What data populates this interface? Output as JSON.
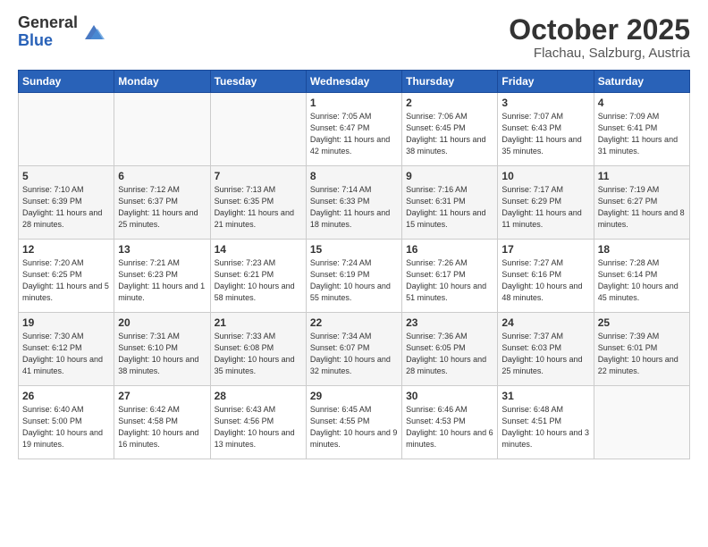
{
  "header": {
    "logo_general": "General",
    "logo_blue": "Blue",
    "month_title": "October 2025",
    "location": "Flachau, Salzburg, Austria"
  },
  "days_of_week": [
    "Sunday",
    "Monday",
    "Tuesday",
    "Wednesday",
    "Thursday",
    "Friday",
    "Saturday"
  ],
  "weeks": [
    [
      {
        "day": "",
        "sunrise": "",
        "sunset": "",
        "daylight": ""
      },
      {
        "day": "",
        "sunrise": "",
        "sunset": "",
        "daylight": ""
      },
      {
        "day": "",
        "sunrise": "",
        "sunset": "",
        "daylight": ""
      },
      {
        "day": "1",
        "sunrise": "Sunrise: 7:05 AM",
        "sunset": "Sunset: 6:47 PM",
        "daylight": "Daylight: 11 hours and 42 minutes."
      },
      {
        "day": "2",
        "sunrise": "Sunrise: 7:06 AM",
        "sunset": "Sunset: 6:45 PM",
        "daylight": "Daylight: 11 hours and 38 minutes."
      },
      {
        "day": "3",
        "sunrise": "Sunrise: 7:07 AM",
        "sunset": "Sunset: 6:43 PM",
        "daylight": "Daylight: 11 hours and 35 minutes."
      },
      {
        "day": "4",
        "sunrise": "Sunrise: 7:09 AM",
        "sunset": "Sunset: 6:41 PM",
        "daylight": "Daylight: 11 hours and 31 minutes."
      }
    ],
    [
      {
        "day": "5",
        "sunrise": "Sunrise: 7:10 AM",
        "sunset": "Sunset: 6:39 PM",
        "daylight": "Daylight: 11 hours and 28 minutes."
      },
      {
        "day": "6",
        "sunrise": "Sunrise: 7:12 AM",
        "sunset": "Sunset: 6:37 PM",
        "daylight": "Daylight: 11 hours and 25 minutes."
      },
      {
        "day": "7",
        "sunrise": "Sunrise: 7:13 AM",
        "sunset": "Sunset: 6:35 PM",
        "daylight": "Daylight: 11 hours and 21 minutes."
      },
      {
        "day": "8",
        "sunrise": "Sunrise: 7:14 AM",
        "sunset": "Sunset: 6:33 PM",
        "daylight": "Daylight: 11 hours and 18 minutes."
      },
      {
        "day": "9",
        "sunrise": "Sunrise: 7:16 AM",
        "sunset": "Sunset: 6:31 PM",
        "daylight": "Daylight: 11 hours and 15 minutes."
      },
      {
        "day": "10",
        "sunrise": "Sunrise: 7:17 AM",
        "sunset": "Sunset: 6:29 PM",
        "daylight": "Daylight: 11 hours and 11 minutes."
      },
      {
        "day": "11",
        "sunrise": "Sunrise: 7:19 AM",
        "sunset": "Sunset: 6:27 PM",
        "daylight": "Daylight: 11 hours and 8 minutes."
      }
    ],
    [
      {
        "day": "12",
        "sunrise": "Sunrise: 7:20 AM",
        "sunset": "Sunset: 6:25 PM",
        "daylight": "Daylight: 11 hours and 5 minutes."
      },
      {
        "day": "13",
        "sunrise": "Sunrise: 7:21 AM",
        "sunset": "Sunset: 6:23 PM",
        "daylight": "Daylight: 11 hours and 1 minute."
      },
      {
        "day": "14",
        "sunrise": "Sunrise: 7:23 AM",
        "sunset": "Sunset: 6:21 PM",
        "daylight": "Daylight: 10 hours and 58 minutes."
      },
      {
        "day": "15",
        "sunrise": "Sunrise: 7:24 AM",
        "sunset": "Sunset: 6:19 PM",
        "daylight": "Daylight: 10 hours and 55 minutes."
      },
      {
        "day": "16",
        "sunrise": "Sunrise: 7:26 AM",
        "sunset": "Sunset: 6:17 PM",
        "daylight": "Daylight: 10 hours and 51 minutes."
      },
      {
        "day": "17",
        "sunrise": "Sunrise: 7:27 AM",
        "sunset": "Sunset: 6:16 PM",
        "daylight": "Daylight: 10 hours and 48 minutes."
      },
      {
        "day": "18",
        "sunrise": "Sunrise: 7:28 AM",
        "sunset": "Sunset: 6:14 PM",
        "daylight": "Daylight: 10 hours and 45 minutes."
      }
    ],
    [
      {
        "day": "19",
        "sunrise": "Sunrise: 7:30 AM",
        "sunset": "Sunset: 6:12 PM",
        "daylight": "Daylight: 10 hours and 41 minutes."
      },
      {
        "day": "20",
        "sunrise": "Sunrise: 7:31 AM",
        "sunset": "Sunset: 6:10 PM",
        "daylight": "Daylight: 10 hours and 38 minutes."
      },
      {
        "day": "21",
        "sunrise": "Sunrise: 7:33 AM",
        "sunset": "Sunset: 6:08 PM",
        "daylight": "Daylight: 10 hours and 35 minutes."
      },
      {
        "day": "22",
        "sunrise": "Sunrise: 7:34 AM",
        "sunset": "Sunset: 6:07 PM",
        "daylight": "Daylight: 10 hours and 32 minutes."
      },
      {
        "day": "23",
        "sunrise": "Sunrise: 7:36 AM",
        "sunset": "Sunset: 6:05 PM",
        "daylight": "Daylight: 10 hours and 28 minutes."
      },
      {
        "day": "24",
        "sunrise": "Sunrise: 7:37 AM",
        "sunset": "Sunset: 6:03 PM",
        "daylight": "Daylight: 10 hours and 25 minutes."
      },
      {
        "day": "25",
        "sunrise": "Sunrise: 7:39 AM",
        "sunset": "Sunset: 6:01 PM",
        "daylight": "Daylight: 10 hours and 22 minutes."
      }
    ],
    [
      {
        "day": "26",
        "sunrise": "Sunrise: 6:40 AM",
        "sunset": "Sunset: 5:00 PM",
        "daylight": "Daylight: 10 hours and 19 minutes."
      },
      {
        "day": "27",
        "sunrise": "Sunrise: 6:42 AM",
        "sunset": "Sunset: 4:58 PM",
        "daylight": "Daylight: 10 hours and 16 minutes."
      },
      {
        "day": "28",
        "sunrise": "Sunrise: 6:43 AM",
        "sunset": "Sunset: 4:56 PM",
        "daylight": "Daylight: 10 hours and 13 minutes."
      },
      {
        "day": "29",
        "sunrise": "Sunrise: 6:45 AM",
        "sunset": "Sunset: 4:55 PM",
        "daylight": "Daylight: 10 hours and 9 minutes."
      },
      {
        "day": "30",
        "sunrise": "Sunrise: 6:46 AM",
        "sunset": "Sunset: 4:53 PM",
        "daylight": "Daylight: 10 hours and 6 minutes."
      },
      {
        "day": "31",
        "sunrise": "Sunrise: 6:48 AM",
        "sunset": "Sunset: 4:51 PM",
        "daylight": "Daylight: 10 hours and 3 minutes."
      },
      {
        "day": "",
        "sunrise": "",
        "sunset": "",
        "daylight": ""
      }
    ]
  ]
}
